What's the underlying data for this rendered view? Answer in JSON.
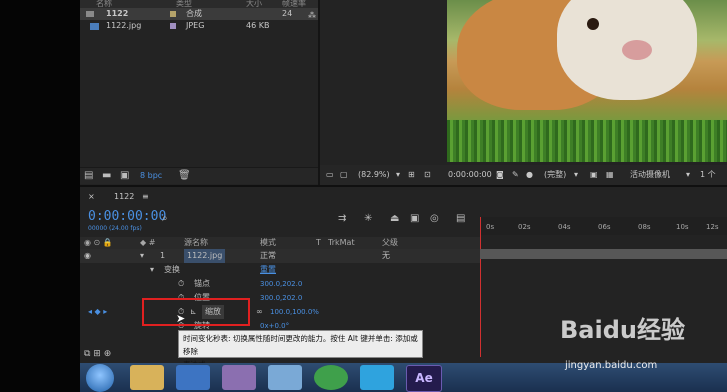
{
  "project": {
    "headers": [
      "名称",
      "类型",
      "大小",
      "帧速率"
    ],
    "items": [
      {
        "name": "1122",
        "type": "合成",
        "size": "",
        "rate": "24"
      },
      {
        "name": "1122.jpg",
        "type": "JPEG",
        "size": "46 KB",
        "rate": ""
      }
    ],
    "bpc": "8 bpc"
  },
  "viewer": {
    "zoom": "(82.9%)",
    "time": "0:00:00:00",
    "res": "(完整)",
    "view": "1 个",
    "camera": "活动摄像机"
  },
  "timeline": {
    "tab": "1122",
    "timecode": "0:00:00:00",
    "fps": "00000 (24.00 fps)",
    "columns": [
      "源名称",
      "模式",
      "T",
      "TrkMat",
      "父级"
    ],
    "layer": {
      "index": "1",
      "name": "1122.jpg",
      "mode": "正常",
      "parent": "无"
    },
    "transform": "变换",
    "reset": "重置",
    "props": [
      {
        "name": "锚点",
        "value": "300.0,202.0"
      },
      {
        "name": "位置",
        "value": "300.0,202.0"
      },
      {
        "name": "缩放",
        "value": "100.0,100.0%"
      },
      {
        "name": "旋转",
        "value": "0x+0.0°"
      }
    ],
    "ruler": [
      "0s",
      "02s",
      "04s",
      "06s",
      "08s",
      "10s",
      "12s"
    ]
  },
  "tooltip": {
    "line1": "时间变化秒表: 切换属性随时间更改的能力。按住 Alt 键并单击: 添加或移除",
    "line2": "表达式。"
  },
  "watermark": {
    "main": "Baidu经验",
    "sub": "jingyan.baidu.com"
  }
}
